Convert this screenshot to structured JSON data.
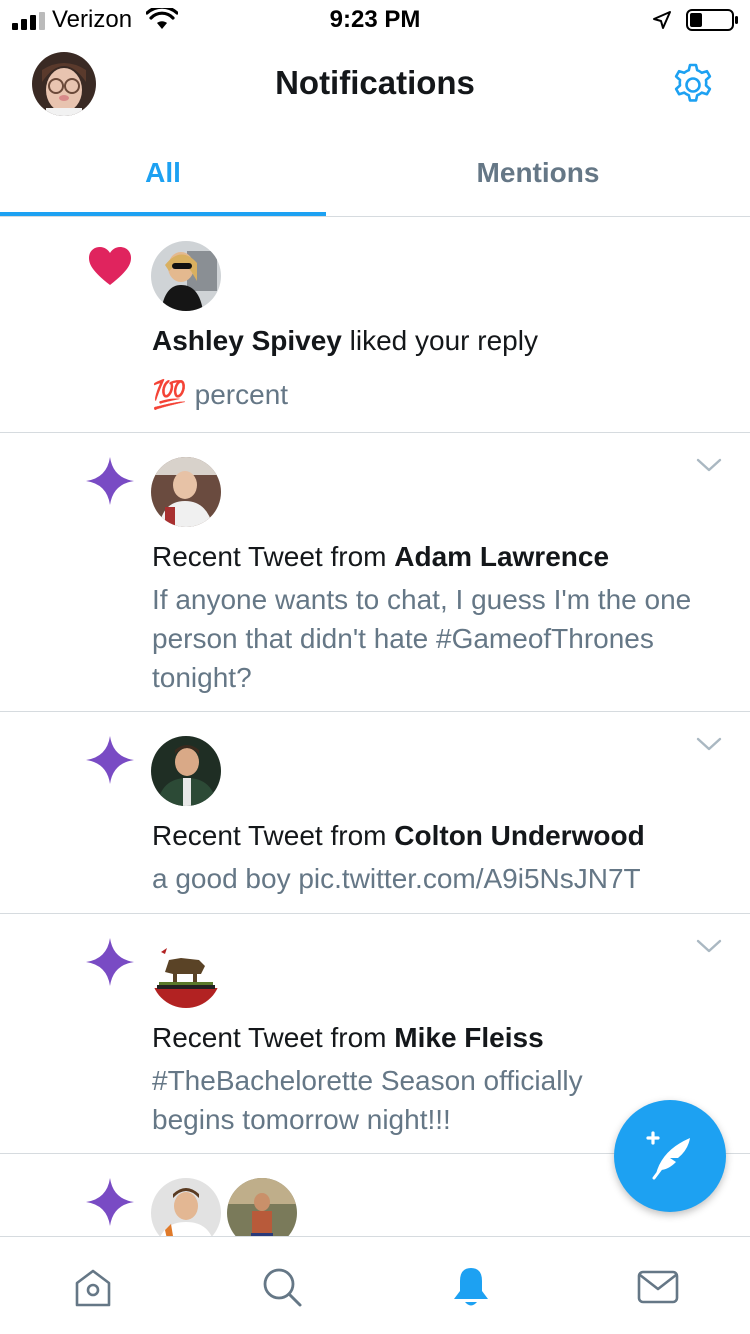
{
  "status_bar": {
    "carrier": "Verizon",
    "time": "9:23 PM"
  },
  "header": {
    "title": "Notifications"
  },
  "tabs": [
    {
      "label": "All",
      "active": true
    },
    {
      "label": "Mentions",
      "active": false
    }
  ],
  "notifications": [
    {
      "icon": "heart-icon",
      "actor": "Ashley Spivey",
      "action": " liked your reply",
      "emoji": "💯",
      "preview": "percent"
    },
    {
      "icon": "sparkle-icon",
      "prefix": "Recent Tweet from ",
      "actor": "Adam Lawrence",
      "body": "If anyone wants to chat, I guess I'm the one person that didn't hate #GameofThrones tonight?"
    },
    {
      "icon": "sparkle-icon",
      "prefix": "Recent Tweet from ",
      "actor": "Colton Underwood",
      "body": "a good boy pic.twitter.com/A9i5NsJN7T"
    },
    {
      "icon": "sparkle-icon",
      "prefix": "Recent Tweet from ",
      "actor": "Mike Fleiss",
      "body": "#TheBachelorette Season officially begins tomorrow night!!!"
    },
    {
      "icon": "sparkle-icon"
    }
  ],
  "colors": {
    "accent": "#1da1f2",
    "heart": "#e0245e",
    "sparkle": "#794bc4",
    "muted": "#657786"
  },
  "tabbar": [
    "home-icon",
    "search-icon",
    "notifications-bell-icon",
    "messages-icon"
  ]
}
